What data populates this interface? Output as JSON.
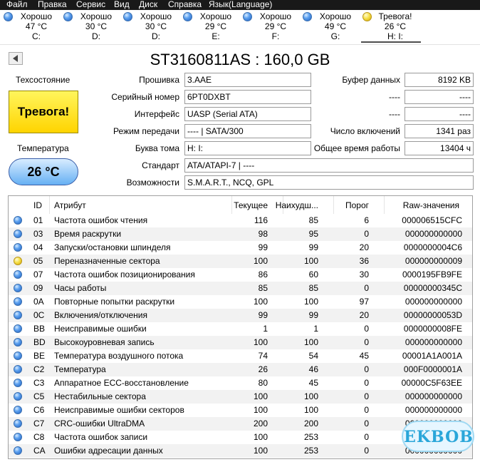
{
  "menu": [
    "Файл",
    "Правка",
    "Сервис",
    "Вид",
    "Диск",
    "Справка",
    "Язык(Language)"
  ],
  "drives": [
    {
      "status": "Хорошо",
      "temp": "47 °C",
      "letter": "C:",
      "color": "blue",
      "selected": false
    },
    {
      "status": "Хорошо",
      "temp": "30 °C",
      "letter": "D:",
      "color": "blue",
      "selected": false
    },
    {
      "status": "Хорошо",
      "temp": "30 °C",
      "letter": "D:",
      "color": "blue",
      "selected": false
    },
    {
      "status": "Хорошо",
      "temp": "29 °C",
      "letter": "E:",
      "color": "blue",
      "selected": false
    },
    {
      "status": "Хорошо",
      "temp": "29 °C",
      "letter": "F:",
      "color": "blue",
      "selected": false
    },
    {
      "status": "Хорошо",
      "temp": "49 °C",
      "letter": "G:",
      "color": "blue",
      "selected": false
    },
    {
      "status": "Тревога!",
      "temp": "26 °C",
      "letter": "H: I:",
      "color": "yellow",
      "selected": true
    }
  ],
  "title": "ST3160811AS : 160,0 GB",
  "health": {
    "label": "Техсостояние",
    "value": "Тревога!",
    "color": "#ffe000"
  },
  "temperature": {
    "label": "Температура",
    "value": "26 °C"
  },
  "info": {
    "firmware": {
      "label": "Прошивка",
      "value": "3.AAE"
    },
    "serial": {
      "label": "Серийный номер",
      "value": "6PT0DXBT"
    },
    "interface": {
      "label": "Интерфейс",
      "value": "UASP (Serial ATA)"
    },
    "transfer": {
      "label": "Режим передачи",
      "value": "---- | SATA/300"
    },
    "letter": {
      "label": "Буква тома",
      "value": "H: I:"
    },
    "standard": {
      "label": "Стандарт",
      "value": "ATA/ATAPI-7 | ----"
    },
    "features": {
      "label": "Возможности",
      "value": "S.M.A.R.T., NCQ, GPL"
    }
  },
  "right_info": {
    "buffer": {
      "label": "Буфер данных",
      "value": "8192 KB"
    },
    "blank1": {
      "label": "----",
      "value": "----"
    },
    "blank2": {
      "label": "----",
      "value": "----"
    },
    "power_count": {
      "label": "Число включений",
      "value": "1341 раз"
    },
    "power_hours": {
      "label": "Общее время работы",
      "value": "13404 ч"
    }
  },
  "table": {
    "headers": {
      "id": "ID",
      "attr": "Атрибут",
      "current": "Текущее",
      "worst": "Наихудш...",
      "threshold": "Порог",
      "raw": "Raw-значения"
    },
    "rows": [
      {
        "status": "blue",
        "id": "01",
        "attr": "Частота ошибок чтения",
        "current": "116",
        "worst": "85",
        "threshold": "6",
        "raw": "000006515CFC"
      },
      {
        "status": "blue",
        "id": "03",
        "attr": "Время раскрутки",
        "current": "98",
        "worst": "95",
        "threshold": "0",
        "raw": "000000000000"
      },
      {
        "status": "blue",
        "id": "04",
        "attr": "Запуски/остановки шпинделя",
        "current": "99",
        "worst": "99",
        "threshold": "20",
        "raw": "0000000004C6"
      },
      {
        "status": "yellow",
        "id": "05",
        "attr": "Переназначенные сектора",
        "current": "100",
        "worst": "100",
        "threshold": "36",
        "raw": "000000000009"
      },
      {
        "status": "blue",
        "id": "07",
        "attr": "Частота ошибок позиционирования",
        "current": "86",
        "worst": "60",
        "threshold": "30",
        "raw": "0000195FB9FE"
      },
      {
        "status": "blue",
        "id": "09",
        "attr": "Часы работы",
        "current": "85",
        "worst": "85",
        "threshold": "0",
        "raw": "00000000345C"
      },
      {
        "status": "blue",
        "id": "0A",
        "attr": "Повторные попытки раскрутки",
        "current": "100",
        "worst": "100",
        "threshold": "97",
        "raw": "000000000000"
      },
      {
        "status": "blue",
        "id": "0C",
        "attr": "Включения/отключения",
        "current": "99",
        "worst": "99",
        "threshold": "20",
        "raw": "00000000053D"
      },
      {
        "status": "blue",
        "id": "BB",
        "attr": "Неисправимые ошибки",
        "current": "1",
        "worst": "1",
        "threshold": "0",
        "raw": "0000000008FE"
      },
      {
        "status": "blue",
        "id": "BD",
        "attr": "Высокоуровневая запись",
        "current": "100",
        "worst": "100",
        "threshold": "0",
        "raw": "000000000000"
      },
      {
        "status": "blue",
        "id": "BE",
        "attr": "Температура воздушного потока",
        "current": "74",
        "worst": "54",
        "threshold": "45",
        "raw": "00001A1A001A"
      },
      {
        "status": "blue",
        "id": "C2",
        "attr": "Температура",
        "current": "26",
        "worst": "46",
        "threshold": "0",
        "raw": "000F0000001A"
      },
      {
        "status": "blue",
        "id": "C3",
        "attr": "Аппаратное ECC-восстановление",
        "current": "80",
        "worst": "45",
        "threshold": "0",
        "raw": "00000C5F63EE"
      },
      {
        "status": "blue",
        "id": "C5",
        "attr": "Нестабильные сектора",
        "current": "100",
        "worst": "100",
        "threshold": "0",
        "raw": "000000000000"
      },
      {
        "status": "blue",
        "id": "C6",
        "attr": "Неисправимые ошибки секторов",
        "current": "100",
        "worst": "100",
        "threshold": "0",
        "raw": "000000000000"
      },
      {
        "status": "blue",
        "id": "C7",
        "attr": "CRC-ошибки UltraDMA",
        "current": "200",
        "worst": "200",
        "threshold": "0",
        "raw": "000000000000"
      },
      {
        "status": "blue",
        "id": "C8",
        "attr": "Частота ошибок записи",
        "current": "100",
        "worst": "253",
        "threshold": "0",
        "raw": "000000000000"
      },
      {
        "status": "blue",
        "id": "CA",
        "attr": "Ошибки адресации данных",
        "current": "100",
        "worst": "253",
        "threshold": "0",
        "raw": "000000000000"
      }
    ]
  },
  "watermark": "EKBOB"
}
